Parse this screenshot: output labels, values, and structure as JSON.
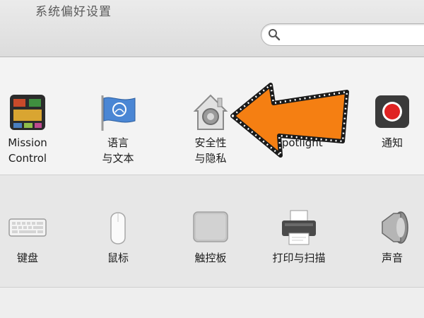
{
  "window": {
    "title": "系统偏好设置"
  },
  "search": {
    "placeholder": ""
  },
  "personal_row": {
    "items": [
      {
        "label": "Mission\nControl",
        "icon": "mission-control-icon"
      },
      {
        "label": "语言\n与文本",
        "icon": "language-flag-icon"
      },
      {
        "label": "安全性\n与隐私",
        "icon": "security-house-icon"
      },
      {
        "label": "Spotlight",
        "icon": "spotlight-icon"
      },
      {
        "label": "通知",
        "icon": "notifications-icon"
      }
    ]
  },
  "hardware_row": {
    "items": [
      {
        "label": "键盘",
        "icon": "keyboard-icon"
      },
      {
        "label": "鼠标",
        "icon": "mouse-icon"
      },
      {
        "label": "触控板",
        "icon": "trackpad-icon"
      },
      {
        "label": "打印与扫描",
        "icon": "printer-icon"
      },
      {
        "label": "声音",
        "icon": "speaker-icon"
      }
    ]
  },
  "overlay": {
    "arrow_color": "#f57f12",
    "arrow_icon": "pointer-arrow-icon"
  }
}
